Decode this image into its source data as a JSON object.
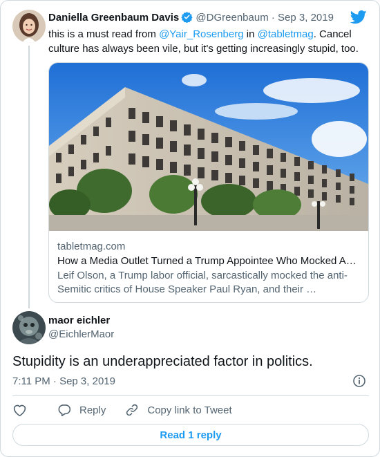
{
  "quoted_tweet": {
    "author_name": "Daniella Greenbaum Davis",
    "author_handle": "@DGreenbaum",
    "separator": "·",
    "date": "Sep 3, 2019",
    "text_before": "this is a must read from ",
    "mention_1": "@Yair_Rosenberg",
    "text_middle": " in ",
    "mention_2": "@tabletmag",
    "text_after": ". Cancel culture has always been vile, but it's getting increasingly stupid, too.",
    "link_card": {
      "domain": "tabletmag.com",
      "title": "How a Media Outlet Turned a Trump Appointee Who Mocked A…",
      "description": "Leif Olson, a Trump labor official, sarcastically mocked the anti-Semitic critics of House Speaker Paul Ryan, and their …"
    }
  },
  "main_tweet": {
    "author_name": "maor eichler",
    "author_handle": "@EichlerMaor",
    "text": "Stupidity is an underappreciated factor in politics.",
    "timestamp": "7:11 PM · Sep 3, 2019"
  },
  "actions": {
    "reply_label": "Reply",
    "copy_label": "Copy link to Tweet"
  },
  "read_reply_label": "Read 1 reply",
  "icons": {
    "brand": "twitter-bird-icon",
    "verified": "verified-badge-icon",
    "info": "info-icon",
    "like": "heart-icon",
    "reply": "reply-bubble-icon",
    "copy": "link-icon"
  },
  "colors": {
    "accent": "#1d9bf0",
    "text": "#0f1419",
    "secondary_text": "#536471",
    "border": "#cfd9de"
  }
}
